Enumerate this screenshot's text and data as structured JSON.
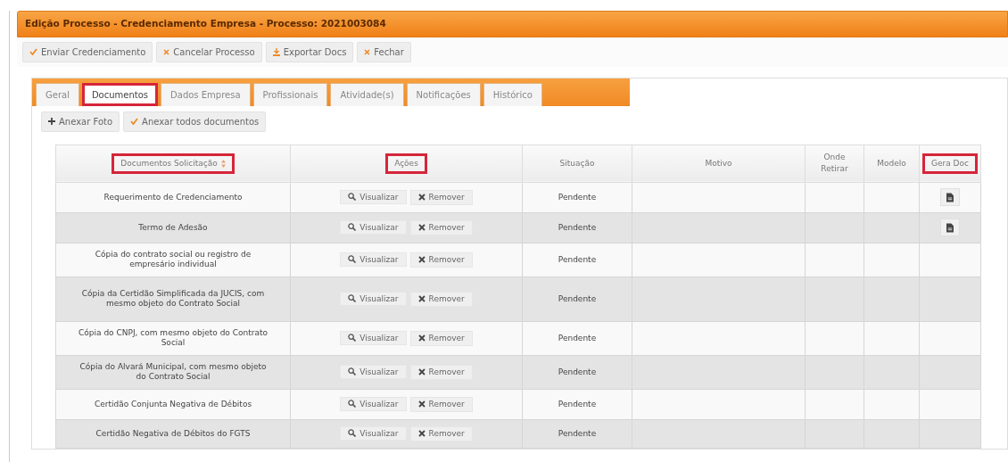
{
  "window": {
    "title": "Edição Processo - Credenciamento Empresa - Processo: 2021003084"
  },
  "toolbar": [
    {
      "label": "Enviar Credenciamento",
      "kind": "check"
    },
    {
      "label": "Cancelar Processo",
      "kind": "cancel"
    },
    {
      "label": "Exportar Docs",
      "kind": "export"
    },
    {
      "label": "Fechar",
      "kind": "cancel"
    }
  ],
  "tabs": [
    {
      "label": "Geral",
      "selected": false,
      "highlighted": false
    },
    {
      "label": "Documentos",
      "selected": true,
      "highlighted": true
    },
    {
      "label": "Dados Empresa",
      "selected": false,
      "highlighted": false
    },
    {
      "label": "Profissionais",
      "selected": false,
      "highlighted": false
    },
    {
      "label": "Atividade(s)",
      "selected": false,
      "highlighted": false
    },
    {
      "label": "Notificações",
      "selected": false,
      "highlighted": false
    },
    {
      "label": "Histórico",
      "selected": false,
      "highlighted": false
    }
  ],
  "attach_buttons": [
    {
      "label": "Anexar Foto",
      "kind": "plus"
    },
    {
      "label": "Anexar todos documentos",
      "kind": "check"
    }
  ],
  "table": {
    "columns": [
      {
        "label": "Documentos Solicitação",
        "highlighted": true,
        "sortable": true
      },
      {
        "label": "Ações",
        "highlighted": true,
        "sortable": false
      },
      {
        "label": "Situação",
        "highlighted": false,
        "sortable": false
      },
      {
        "label": "Motivo",
        "highlighted": false,
        "sortable": false
      },
      {
        "label": "Onde Retirar",
        "highlighted": false,
        "sortable": false
      },
      {
        "label": "Modelo",
        "highlighted": false,
        "sortable": false
      },
      {
        "label": "Gera Doc",
        "highlighted": true,
        "sortable": false
      }
    ],
    "rows": [
      {
        "document": "Requerimento de Credenciamento",
        "actions": [
          {
            "label": "Visualizar",
            "kind": "view"
          },
          {
            "label": "Remover",
            "kind": "remove"
          }
        ],
        "status": "Pendente",
        "generate_doc": true
      },
      {
        "document": "Termo de Adesão",
        "actions": [
          {
            "label": "Visualizar",
            "kind": "view"
          },
          {
            "label": "Remover",
            "kind": "remove"
          }
        ],
        "status": "Pendente",
        "generate_doc": true
      },
      {
        "document": "Cópia do contrato social ou registro de empresário individual",
        "actions": [
          {
            "label": "Visualizar",
            "kind": "view"
          },
          {
            "label": "Remover",
            "kind": "remove"
          }
        ],
        "status": "Pendente",
        "generate_doc": false
      },
      {
        "document": "Cópia da Certidão Simplificada da JUCIS, com mesmo objeto do Contrato Social",
        "actions": [
          {
            "label": "Visualizar",
            "kind": "view"
          },
          {
            "label": "Remover",
            "kind": "remove"
          }
        ],
        "status": "Pendente",
        "generate_doc": false
      },
      {
        "document": "Cópia do CNPJ, com mesmo objeto do Contrato Social",
        "actions": [
          {
            "label": "Visualizar",
            "kind": "view"
          },
          {
            "label": "Remover",
            "kind": "remove"
          }
        ],
        "status": "Pendente",
        "generate_doc": false
      },
      {
        "document": "Cópia do Alvará Municipal, com mesmo objeto do Contrato Social",
        "actions": [
          {
            "label": "Visualizar",
            "kind": "view"
          },
          {
            "label": "Remover",
            "kind": "remove"
          }
        ],
        "status": "Pendente",
        "generate_doc": false
      },
      {
        "document": "Certidão Conjunta Negativa de Débitos",
        "actions": [
          {
            "label": "Visualizar",
            "kind": "view"
          },
          {
            "label": "Remover",
            "kind": "remove"
          }
        ],
        "status": "Pendente",
        "generate_doc": false
      },
      {
        "document": "Certidão Negativa de Débitos do FGTS",
        "actions": [
          {
            "label": "Visualizar",
            "kind": "view"
          },
          {
            "label": "Remover",
            "kind": "remove"
          }
        ],
        "status": "Pendente",
        "generate_doc": false
      }
    ]
  }
}
